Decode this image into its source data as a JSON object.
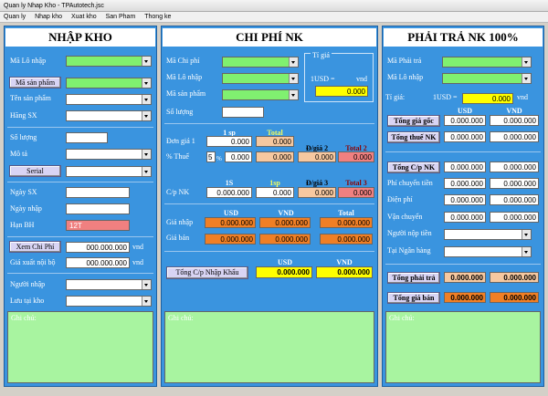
{
  "window": {
    "title": "Quan ly Nhap Kho - TPAutotech.jsc"
  },
  "menu": [
    "Quan ly",
    "Nhap kho",
    "Xuat kho",
    "San Pham",
    "Thong ke"
  ],
  "left": {
    "title": "NHẬP KHO",
    "ma_lo_nhap": "Mã Lô nhập",
    "ma_san_pham": "Mã sản phẩm",
    "ten_san_pham": "Tên sản phẩm",
    "hang_sx": "Hãng SX",
    "so_luong": "Số lượng",
    "mo_ta": "Mô tả",
    "serial": "Serial",
    "ngay_sx": "Ngày SX",
    "ngay_nhap": "Ngày nhập",
    "han_bh": "Hạn BH",
    "han_bh_value": "12T",
    "xem_chi_phi": "Xem Chi Phí",
    "chi_phi_value": "000.000.000",
    "vnd": "vnd",
    "gia_xuat": "Giá xuất nội bộ",
    "gia_xuat_value": "000.000.000",
    "nguoi_nhap": "Người nhập",
    "luu_tai_kho": "Lưu tại kho",
    "ghi_chu": "Ghi chú:"
  },
  "middle": {
    "title": "CHI PHÍ NK",
    "ma_chi_phi": "Mã Chi phí",
    "ma_lo_nhap": "Mã Lô nhập",
    "ma_san_pham": "Mã sản phẩm",
    "so_luong": "Số lượng",
    "ti_gia": "Tỉ giá",
    "usd_eq": "1USD =",
    "vnd": "vnd",
    "ti_gia_value": "0.000",
    "h_1sp": "1 sp",
    "h_total": "Total",
    "don_gia_1": "Đơn giá 1",
    "dg1_val": "0.000",
    "dg1_total": "0.000",
    "thue_pct": "% Thuế",
    "thue_rate": "5",
    "thue_unit": "%",
    "thue_val": "0.000",
    "thue_total": "0.000",
    "h_dg2": "Đ/giá 2",
    "h_total2": "Total 2",
    "dg2_val": "0.000",
    "dg2_total": "0.000",
    "h_1s": "1S",
    "h_1sp_b": "1sp",
    "h_dg3": "Đ/giá 3",
    "h_total3": "Total 3",
    "cp_nk": "C/p NK",
    "cp_1s": "0.000.000",
    "cp_1sp": "0.000",
    "cp_dg3": "0.000",
    "cp_total3": "0.000",
    "h_usd": "USD",
    "h_vnd": "VND",
    "h_total_b": "Total",
    "gia_nhap": "Giá nhập",
    "gia_ban": "Giá bán",
    "gn_usd": "0.000.000",
    "gn_vnd": "0.000.000",
    "gn_total": "0.000.000",
    "gb_usd": "0.000.000",
    "gb_vnd": "0.000.000",
    "gb_total": "0.000.000",
    "tong_cp_btn": "Tổng C/p Nhập Khẩu",
    "tong_usd": "0.000.000",
    "tong_vnd": "0.000.000",
    "ghi_chu": "Ghi chú:"
  },
  "right": {
    "title": "PHẢI TRẢ NK 100%",
    "ma_phai_tra": "Mã Phải trả",
    "ma_lo_nhap": "Mã Lô nhập",
    "ti_gia": "Tỉ giá:",
    "usd_eq": "1USD =",
    "ti_gia_value": "0.000",
    "vnd": "vnd",
    "h_usd": "USD",
    "h_vnd": "VND",
    "tong_gia_goc": "Tổng giá gốc",
    "tgg_usd": "0.000.000",
    "tgg_vnd": "0.000.000",
    "tong_thue_nk": "Tổng thuế NK",
    "ttn_usd": "0.000.000",
    "ttn_vnd": "0.000.000",
    "tong_cp_nk": "Tổng C/p NK",
    "tcp_usd": "0.000.000",
    "tcp_vnd": "0.000.000",
    "phi_chuyen_tien": "Phí chuyển tiền",
    "pct_usd": "0.000.000",
    "pct_vnd": "0.000.000",
    "dien_phi": "Điện phí",
    "dp_usd": "0.000.000",
    "dp_vnd": "0.000.000",
    "van_chuyen": "Vận chuyển",
    "vc_usd": "0.000.000",
    "vc_vnd": "0.000.000",
    "nguoi_nop_tien": "Người nộp tiền",
    "tai_ngan_hang": "Tại Ngân hàng",
    "tong_phai_tra": "Tổng phải trả",
    "tpt_usd": "0.000.000",
    "tpt_vnd": "0.000.000",
    "tong_gia_ban": "Tổng giá bán",
    "tgb_usd": "0.000.000",
    "tgb_vnd": "0.000.000",
    "ghi_chu": "Ghi chú:"
  }
}
